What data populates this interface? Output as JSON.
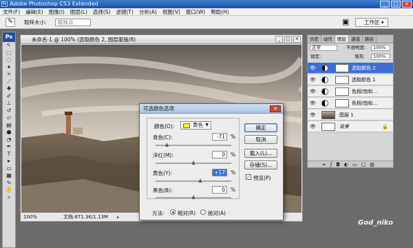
{
  "app": {
    "title": "Adobe Photoshop CS3 Extended",
    "ps_logo": "Ps"
  },
  "window_buttons": {
    "min": "_",
    "max": "□",
    "close": "✕"
  },
  "menu": [
    "文件(F)",
    "编辑(E)",
    "图像(I)",
    "图层(L)",
    "选择(S)",
    "滤镜(T)",
    "分析(A)",
    "视图(V)",
    "窗口(W)",
    "帮助(H)"
  ],
  "options": {
    "sample_size_label": "取样大小:",
    "sample_point": "取样点",
    "workspace": "工作区 ▾"
  },
  "document": {
    "title": "未命名-1 @ 100% (选取颜色 2, 图层蒙版/8)",
    "zoom": "100%",
    "doc_info": "文档:871.3K/1.13M"
  },
  "layers_panel": {
    "tabs": [
      "历史",
      "动作",
      "图层",
      "通道",
      "路径"
    ],
    "blend_mode": "正常",
    "opacity_label": "不透明度:",
    "opacity": "100%",
    "lock_label": "锁定:",
    "fill_label": "填充:",
    "fill": "100%",
    "layers": [
      {
        "name": "选取颜色 2",
        "selected": true
      },
      {
        "name": "选取颜色 1",
        "selected": false
      },
      {
        "name": "色相/饱和...",
        "selected": false
      },
      {
        "name": "色相/饱和...",
        "selected": false
      },
      {
        "name": "图层 1",
        "selected": false
      },
      {
        "name": "背景",
        "selected": false
      }
    ]
  },
  "dialog": {
    "title": "可选颜色选项",
    "colors_label": "颜色(O):",
    "colors_value": "黄色",
    "fields": [
      {
        "label": "青色(C):",
        "value": "-71",
        "unit": "%",
        "fraction": 0.15
      },
      {
        "label": "洋红(M):",
        "value": "0",
        "unit": "%",
        "fraction": 0.5
      },
      {
        "label": "黄色(Y):",
        "value": "+17",
        "unit": "%",
        "fraction": 0.59
      },
      {
        "label": "黑色(B):",
        "value": "0",
        "unit": "%",
        "fraction": 0.5
      }
    ],
    "buttons": {
      "ok": "确定",
      "cancel": "取消",
      "load": "载入(L)...",
      "save": "存储(S)..."
    },
    "preview_label": "预览(P)",
    "preview_checked": true,
    "method_label": "方法:",
    "relative": "相对(R)",
    "absolute": "绝对(A)"
  },
  "watermark": "God_niko",
  "colors": {
    "selected_layer": "#3b6fd8",
    "swatch_yellow": "#ffff00"
  }
}
